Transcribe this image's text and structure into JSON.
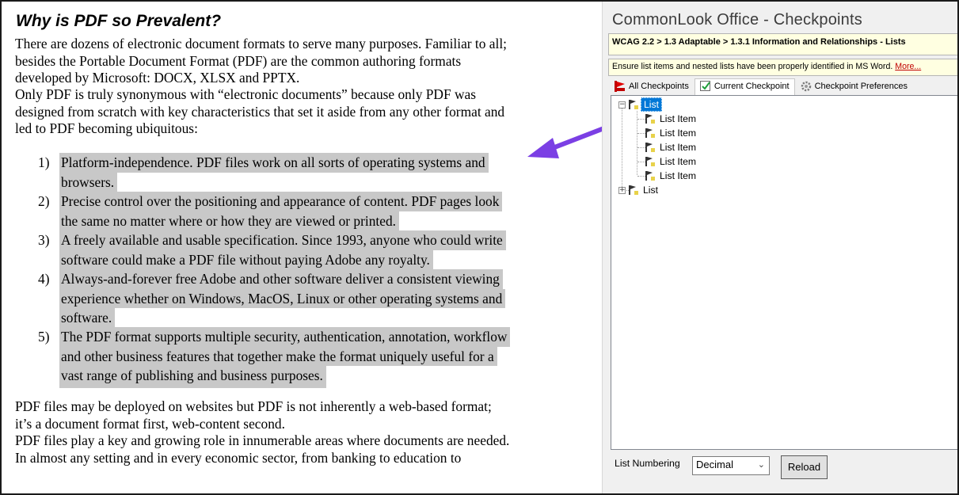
{
  "document": {
    "title": "Why is PDF so Prevalent?",
    "intro_1": [
      "There are dozens of electronic document formats to serve many purposes. Familiar to all;",
      "besides the Portable Document Format (PDF) are the common authoring formats",
      "developed by Microsoft: DOCX, XLSX and PPTX."
    ],
    "intro_2": [
      "Only PDF is truly synonymous with “electronic documents” because only PDF was",
      "designed from scratch with key characteristics that set it aside from any other format and",
      "led to PDF becoming ubiquitous:"
    ],
    "list_items": [
      {
        "number": "1)",
        "lines": [
          "Platform-independence. PDF files work on all sorts of operating systems and",
          "browsers. "
        ]
      },
      {
        "number": "2)",
        "lines": [
          "Precise control over the positioning and appearance of content. PDF pages look",
          "the same no matter where or how they are viewed or printed. "
        ]
      },
      {
        "number": "3)",
        "lines": [
          "A freely available and usable specification. Since 1993, anyone who could write",
          "software could make a PDF file without paying Adobe any royalty. "
        ]
      },
      {
        "number": "4)",
        "lines": [
          "Always-and-forever free Adobe and other software deliver a consistent viewing",
          "experience whether on Windows, MacOS, Linux or other operating systems and",
          "software. "
        ]
      },
      {
        "number": "5)",
        "lines": [
          "The PDF format supports multiple security, authentication, annotation, workflow",
          "and other business features that together make the format uniquely useful for a",
          "vast range of publishing and business purposes."
        ]
      }
    ],
    "outro_1": [
      "PDF files may be deployed on websites but PDF is not inherently a web-based format;",
      "it’s a document format first, web-content second."
    ],
    "outro_2": [
      "PDF files play a key and growing role in innumerable areas where documents are needed.",
      "In almost any setting and in every economic sector, from banking to education to"
    ],
    "highlight_color": "#c8c8c8",
    "arrow_color": "#7b3fe4"
  },
  "pane": {
    "title": "CommonLook Office - Checkpoints",
    "breadcrumb": "WCAG 2.2 > 1.3 Adaptable > 1.3.1 Information and Relationships - Lists",
    "description": "Ensure list items and nested lists have been properly identified in MS Word.",
    "more_link": "More...",
    "tabs": [
      {
        "label": "All Checkpoints",
        "icon": "red-flag-icon"
      },
      {
        "label": "Current Checkpoint",
        "icon": "checkmark-chart-icon",
        "active": true
      },
      {
        "label": "Checkpoint Preferences",
        "icon": "gear-icon"
      }
    ],
    "tree": [
      {
        "label": "List",
        "selected": true,
        "expanded": true,
        "children": [
          "List Item",
          "List Item",
          "List Item",
          "List Item",
          "List Item"
        ]
      },
      {
        "label": "List",
        "expanded": false
      }
    ],
    "numbering_label": "List Numbering",
    "numbering_value": "Decimal",
    "reload_label": "Reload",
    "accent": "#0078d7",
    "note_bg": "#ffffe1"
  }
}
